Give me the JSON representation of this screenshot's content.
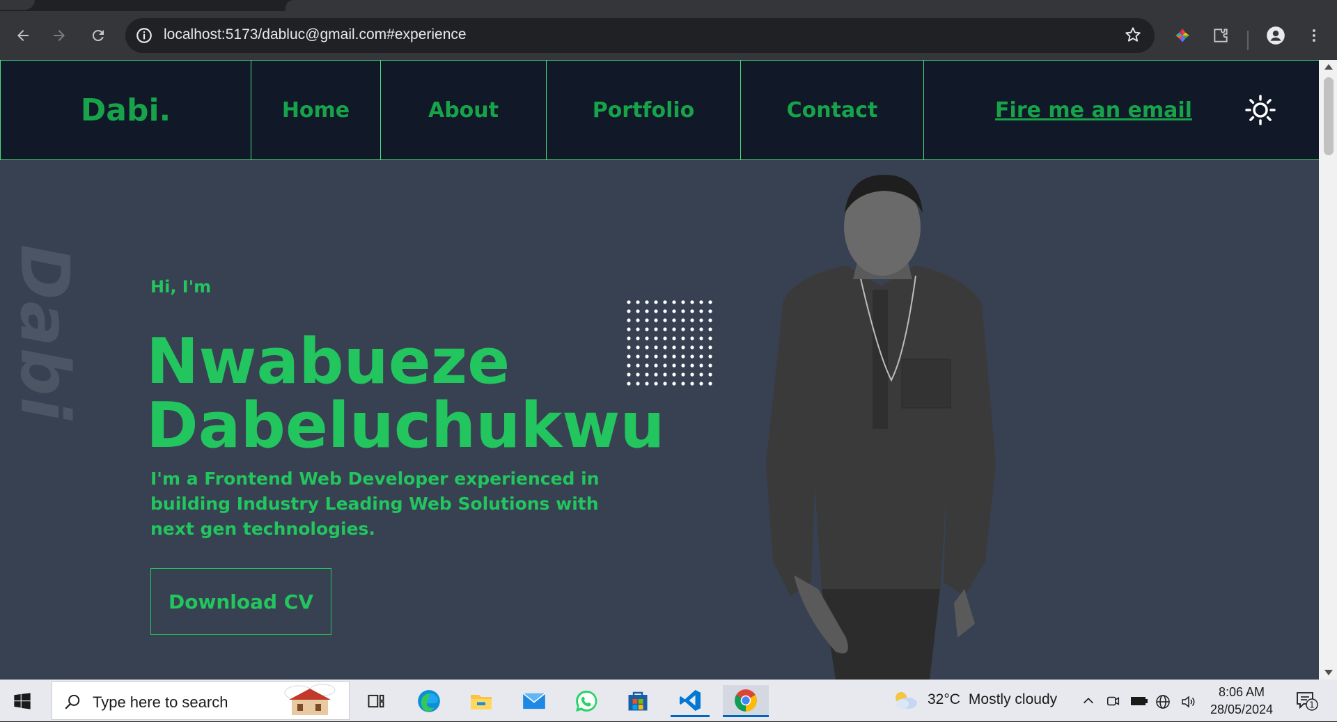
{
  "browser": {
    "url": "localhost:5173/dabluc@gmail.com#experience"
  },
  "nav": {
    "logo": "Dabi.",
    "items": [
      "Home",
      "About",
      "Portfolio",
      "Contact"
    ],
    "email_link": "Fire me an email",
    "theme_icon": "sun-icon"
  },
  "hero": {
    "side_word": "Dabi",
    "greeting": "Hi, I'm",
    "name_line1": "Nwabueze",
    "name_line2": "Dabeluchukwu",
    "tagline": "I'm a Frontend Web Developer experienced in building Industry Leading Web Solutions with next gen technologies.",
    "cv_button": "Download CV"
  },
  "colors": {
    "nav_bg": "#111827",
    "page_bg": "#374151",
    "accent": "#22c55e",
    "nav_text": "#16a34a"
  },
  "taskbar": {
    "search_placeholder": "Type here to search",
    "weather_temp": "32°C",
    "weather_desc": "Mostly cloudy",
    "time": "8:06 AM",
    "date": "28/05/2024",
    "notification_count": "1"
  }
}
